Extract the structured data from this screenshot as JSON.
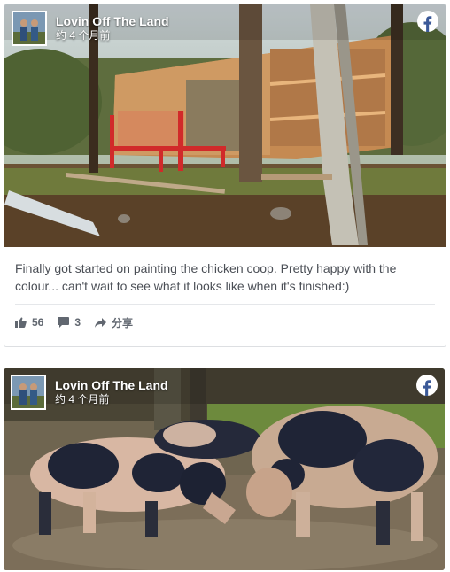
{
  "posts": [
    {
      "page_name": "Lovin Off The Land",
      "time": "约 4 个月前",
      "caption": "Finally got started on painting the chicken coop. Pretty happy with the colour... can't wait to see what it looks like when it's finished:)",
      "likes": "56",
      "comments": "3",
      "share_label": "分享"
    },
    {
      "page_name": "Lovin Off The Land",
      "time": "约 4 个月前"
    }
  ],
  "icons": [
    "facebook-icon",
    "like-icon",
    "comment-icon",
    "share-icon"
  ],
  "colors": {
    "facebook_blue": "#3b5998",
    "text": "#4b4f56",
    "meta": "#616770",
    "border": "#dddfe2"
  }
}
